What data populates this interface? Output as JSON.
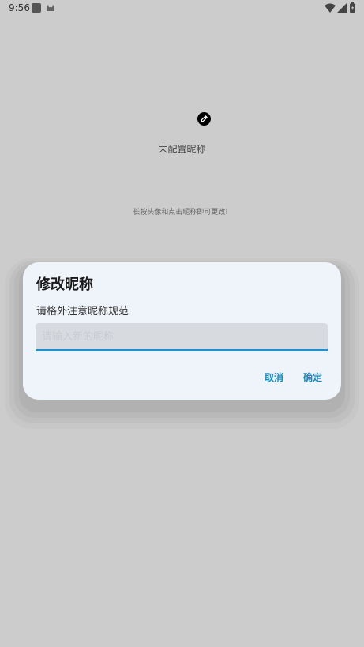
{
  "status_bar": {
    "time": "9:56",
    "icons": [
      "app-notification-icon",
      "cat-icon",
      "wifi-icon",
      "signal-icon",
      "battery-icon"
    ]
  },
  "profile": {
    "edit_icon": "edit-icon",
    "nickname": "未配置昵称",
    "hint": "长按头像和点击昵称即可更改!"
  },
  "dialog": {
    "title": "修改昵称",
    "message": "请格外注意昵称规范",
    "input": {
      "value": "",
      "placeholder": "请输入新的昵称"
    },
    "cancel_label": "取消",
    "confirm_label": "确定",
    "accent_color": "#1e8ab8"
  }
}
